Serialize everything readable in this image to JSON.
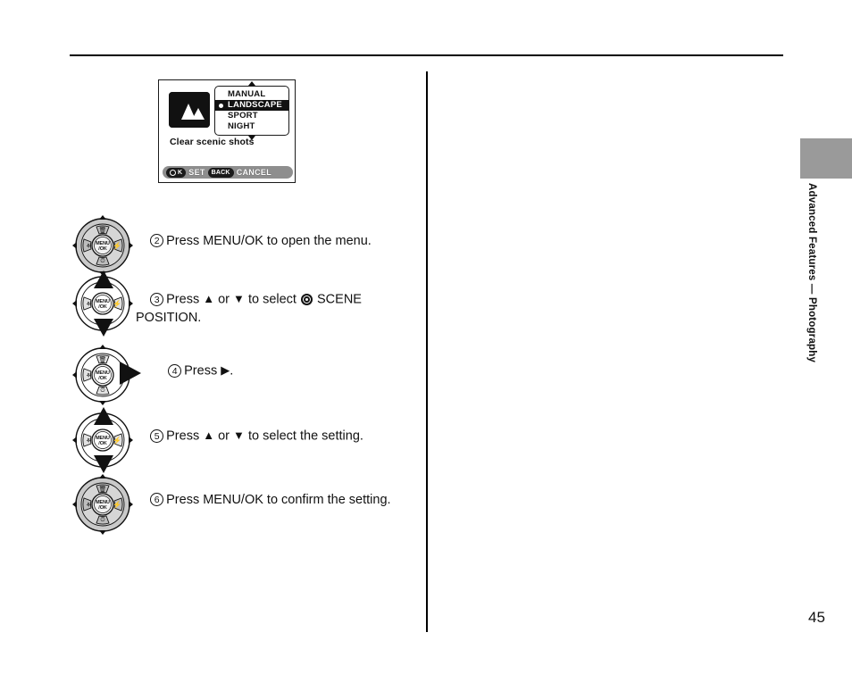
{
  "page": {
    "number": "45",
    "side_title": "Advanced Features — Photography"
  },
  "lcd": {
    "scene_icon_name": "mountain-landscape-icon",
    "menu_items": [
      {
        "label": "MANUAL",
        "selected": false
      },
      {
        "label": "LANDSCAPE",
        "selected": true
      },
      {
        "label": "SPORT",
        "selected": false
      },
      {
        "label": "NIGHT",
        "selected": false
      }
    ],
    "caption": "Clear scenic shots",
    "bottom_bar": {
      "ok_key": "K",
      "ok_label": "SET",
      "back_key": "BACK",
      "back_label": "CANCEL"
    }
  },
  "pad": {
    "center_label_line1": "MENU",
    "center_label_line2": "OK",
    "up_icon": "delete-icon",
    "down_icon": "self-timer-icon",
    "left_icon": "macro-icon",
    "right_icon": "flash-icon"
  },
  "steps": [
    {
      "num": "2",
      "pre": "Press MENU/OK to open the menu.",
      "overlays": []
    },
    {
      "num": "3",
      "seg1": "Press ",
      "up": "▲",
      "seg2": " or ",
      "down": "▼",
      "seg3": " to select ",
      "scene_icon": "scene-position-icon",
      "seg4": " SCENE",
      "seg5": "POSITION.",
      "overlays": [
        "up",
        "down"
      ]
    },
    {
      "num": "4",
      "seg1": "Press ",
      "right": "▶",
      "seg2": ".",
      "overlays": [
        "right"
      ]
    },
    {
      "num": "5",
      "seg1": "Press ",
      "up": "▲",
      "seg2": " or ",
      "down": "▼",
      "seg3": " to select the setting.",
      "overlays": [
        "up",
        "down"
      ]
    },
    {
      "num": "6",
      "pre": "Press MENU/OK to confirm the setting.",
      "overlays": []
    }
  ],
  "colors": {
    "ink": "#111111",
    "tab_gray": "#9a9a9a",
    "bar_gray": "#8e8e8e"
  }
}
